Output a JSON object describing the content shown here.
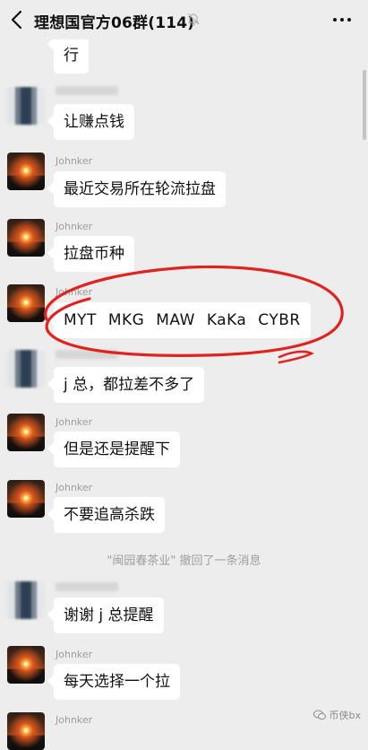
{
  "header": {
    "title": "理想国官方06群(114)",
    "back_icon": "chevron-left-icon",
    "mute_icon": "bell-off-icon",
    "more_icon": "more-dots-icon"
  },
  "messages": [
    {
      "sender": "",
      "text": "行",
      "partial_top": "…"
    },
    {
      "sender": "",
      "text": "让赚点钱"
    },
    {
      "sender": "Johnker",
      "text": "最近交易所在轮流拉盘"
    },
    {
      "sender": "Johnker",
      "text": "拉盘币种"
    },
    {
      "sender": "Johnker",
      "text": "MYT MKG MAW KaKa CYBR"
    },
    {
      "sender": "",
      "text": "j 总，都拉差不多了"
    },
    {
      "sender": "Johnker",
      "text": "但是还是提醒下"
    },
    {
      "sender": "Johnker",
      "text": "不要追高杀跌"
    },
    {
      "sender": "",
      "text": "谢谢 j 总提醒"
    },
    {
      "sender": "Johnker",
      "text": "每天选择一个拉"
    },
    {
      "sender": "Johnker",
      "text": ""
    }
  ],
  "system_notice": "\"闽园春茶业\" 撤回了一条消息",
  "watermark": "币侠bx",
  "colors": {
    "background": "#ededed",
    "bubble": "#ffffff",
    "annotation": "#e0231f"
  }
}
